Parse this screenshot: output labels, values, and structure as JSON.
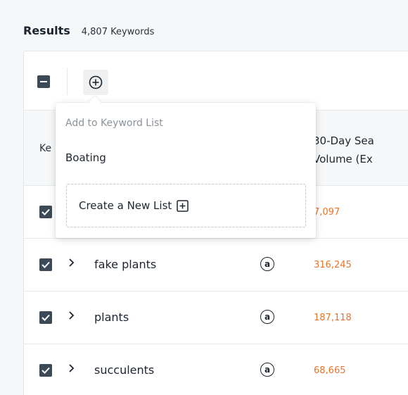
{
  "header": {
    "title": "Results",
    "count": "4,807 Keywords"
  },
  "table": {
    "columns": {
      "keyword": "Ke",
      "volume_line1": "30-Day Sea",
      "volume_line2": "Volume (Ex"
    },
    "rows": [
      {
        "keyword": "",
        "volume": "7,097",
        "checked": true
      },
      {
        "keyword": "fake plants",
        "volume": "316,245",
        "checked": true
      },
      {
        "keyword": "plants",
        "volume": "187,118",
        "checked": true
      },
      {
        "keyword": "succulents",
        "volume": "68,665",
        "checked": true
      }
    ],
    "amazon_icon_glyph": "a"
  },
  "dropdown": {
    "header": "Add to Keyword List",
    "items": [
      "Boating"
    ],
    "create_label": "Create a New List"
  },
  "colors": {
    "volume": "#e8742b",
    "checkbox": "#3c4a57"
  }
}
